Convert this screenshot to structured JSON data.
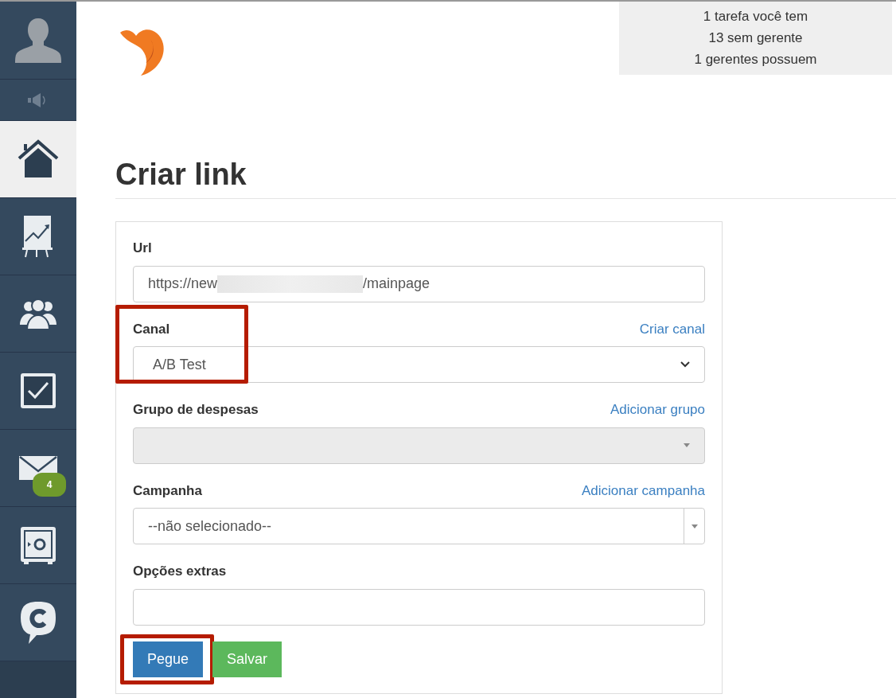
{
  "sidebar": {
    "items": [
      {
        "kind": "avatar",
        "selected": false
      },
      {
        "kind": "sound",
        "selected": false
      },
      {
        "kind": "home",
        "selected": true
      },
      {
        "kind": "chart",
        "selected": false
      },
      {
        "kind": "people",
        "selected": false
      },
      {
        "kind": "tasks",
        "selected": false
      },
      {
        "kind": "mail",
        "selected": false,
        "badge": "4"
      },
      {
        "kind": "safe",
        "selected": false
      },
      {
        "kind": "chat",
        "selected": false
      }
    ]
  },
  "notifications": [
    "1 tarefa você tem",
    "13 sem gerente",
    "1 gerentes possuem"
  ],
  "page_title": "Criar link",
  "form": {
    "fields": [
      {
        "kind": "text",
        "label": "Url",
        "value_start": "https://new",
        "value_end": "/mainpage",
        "redacted": true
      },
      {
        "kind": "select",
        "label": "Canal",
        "link": "Criar canal",
        "value": "A/B Test",
        "highlighted": true
      },
      {
        "kind": "select",
        "label": "Grupo de despesas",
        "link": "Adicionar grupo",
        "disabled": true
      },
      {
        "kind": "combo",
        "label": "Campanha",
        "link": "Adicionar campanha",
        "value": "--não selecionado--"
      },
      {
        "kind": "text",
        "label": "Opções extras"
      }
    ],
    "buttons": [
      {
        "label": "Pegue",
        "kind": "primary",
        "highlighted": true
      },
      {
        "label": "Salvar",
        "kind": "success"
      }
    ]
  }
}
